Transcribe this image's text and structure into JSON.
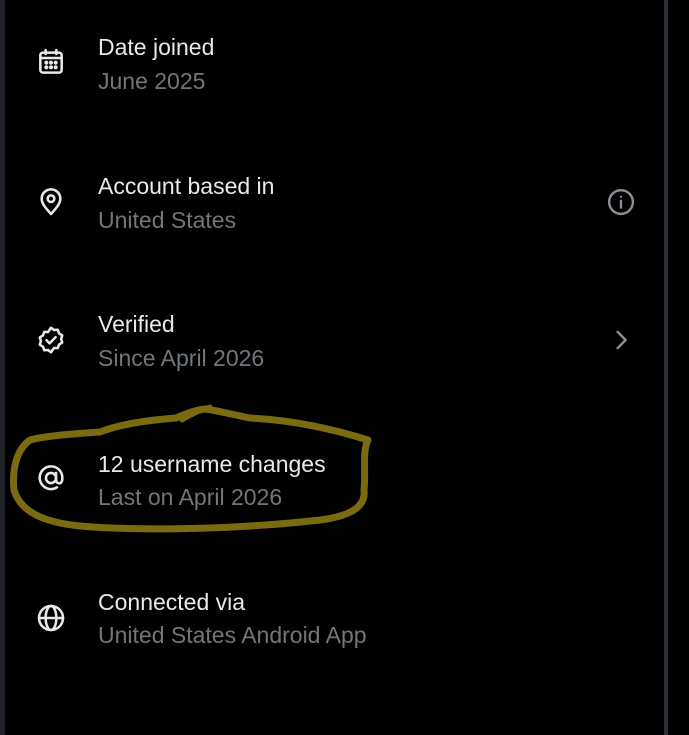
{
  "items": [
    {
      "icon": "calendar-icon",
      "title": "Date joined",
      "subtitle": "June 2025",
      "trail": null
    },
    {
      "icon": "location-pin-icon",
      "title": "Account based in",
      "subtitle": "United States",
      "trail": "info-icon"
    },
    {
      "icon": "verified-badge-icon",
      "title": "Verified",
      "subtitle": "Since April 2026",
      "trail": "chevron-right-icon"
    },
    {
      "icon": "at-sign-icon",
      "title": "12 username changes",
      "subtitle": "Last on April 2026",
      "trail": null
    },
    {
      "icon": "globe-icon",
      "title": "Connected via",
      "subtitle": "United States Android App",
      "trail": null
    }
  ],
  "colors": {
    "background": "#000000",
    "title": "#e7e9ea",
    "subtitle": "#71767b",
    "icon": "#e7e9ea",
    "trail_icon": "#8b9096",
    "highlight_stroke": "#7a6a10"
  }
}
